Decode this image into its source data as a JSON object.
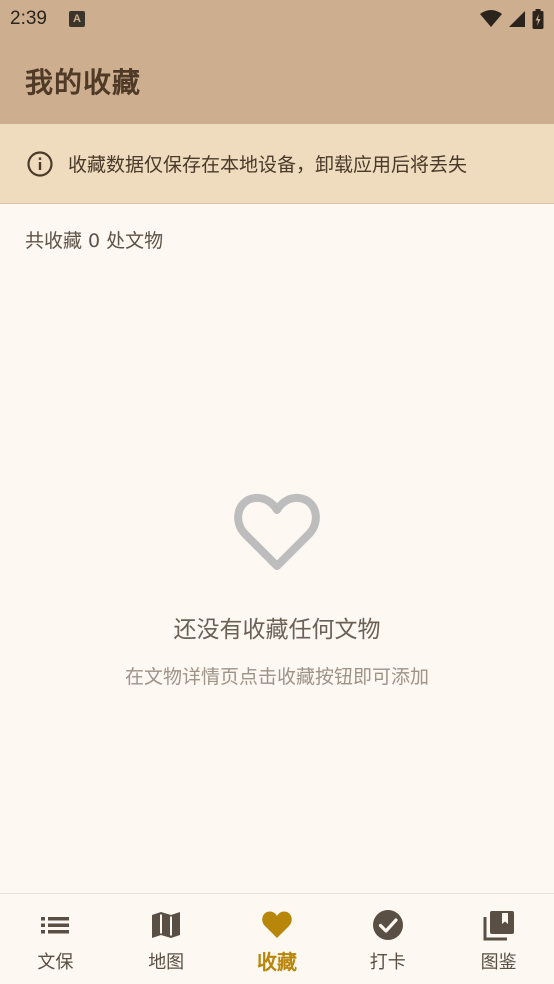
{
  "status_bar": {
    "time": "2:39",
    "notif_letter": "A"
  },
  "app_bar": {
    "title": "我的收藏"
  },
  "notice": {
    "icon": "info-icon",
    "text": "收藏数据仅保存在本地设备，卸载应用后将丢失"
  },
  "summary": {
    "count_text": "共收藏 0 处文物"
  },
  "empty_state": {
    "icon": "heart-outline-icon",
    "title": "还没有收藏任何文物",
    "subtitle": "在文物详情页点击收藏按钮即可添加"
  },
  "bottom_nav": {
    "active_color": "#b8860b",
    "items": [
      {
        "label": "文保",
        "icon": "list-icon",
        "active": false
      },
      {
        "label": "地图",
        "icon": "map-icon",
        "active": false
      },
      {
        "label": "收藏",
        "icon": "heart-icon",
        "active": true
      },
      {
        "label": "打卡",
        "icon": "check-circle-icon",
        "active": false
      },
      {
        "label": "图鉴",
        "icon": "photo-library-icon",
        "active": false
      }
    ]
  },
  "colors": {
    "header": "#cdae8e",
    "notice_bg": "#efdbbd",
    "page_bg": "#fdf8f2"
  }
}
